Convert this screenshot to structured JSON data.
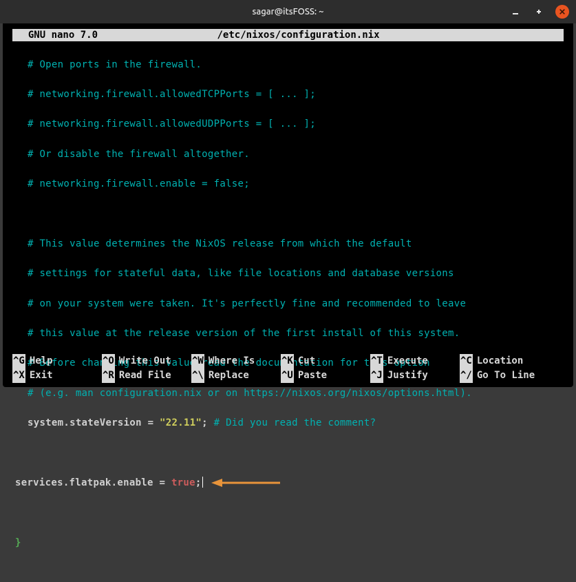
{
  "window": {
    "title": "sagar@itsFOSS: ~"
  },
  "nano": {
    "app": "  GNU nano 7.0",
    "file": "/etc/nixos/configuration.nix"
  },
  "code": {
    "c1": "# Open ports in the firewall.",
    "c2": "# networking.firewall.allowedTCPPorts = [ ... ];",
    "c3": "# networking.firewall.allowedUDPPorts = [ ... ];",
    "c4": "# Or disable the firewall altogether.",
    "c5": "# networking.firewall.enable = false;",
    "c6": "# This value determines the NixOS release from which the default",
    "c7": "# settings for stateful data, like file locations and database versions",
    "c8": "# on your system were taken. It's perfectly fine and recommended to leave",
    "c9": "# this value at the release version of the first install of this system.",
    "c10": "# Before changing this value read the documentation for this option",
    "c11": "# (e.g. man configuration.nix or on https://nixos.org/nixos/options.html).",
    "stateversion_key": "system.stateVersion",
    "eq": " = ",
    "stateversion_val": "\"22.11\"",
    "semi": ";",
    "stateversion_comment": " # Did you read the comment?",
    "flatpak_key": "services.flatpak.enable",
    "flatpak_val": "true",
    "close_brace": "}"
  },
  "shortcuts": {
    "r1": {
      "k1": "^G",
      "l1": "Help",
      "k2": "^O",
      "l2": "Write Out",
      "k3": "^W",
      "l3": "Where Is",
      "k4": "^K",
      "l4": "Cut",
      "k5": "^T",
      "l5": "Execute",
      "k6": "^C",
      "l6": "Location"
    },
    "r2": {
      "k1": "^X",
      "l1": "Exit",
      "k2": "^R",
      "l2": "Read File",
      "k3": "^\\",
      "l3": "Replace",
      "k4": "^U",
      "l4": "Paste",
      "k5": "^J",
      "l5": "Justify",
      "k6": "^/",
      "l6": "Go To Line"
    }
  }
}
